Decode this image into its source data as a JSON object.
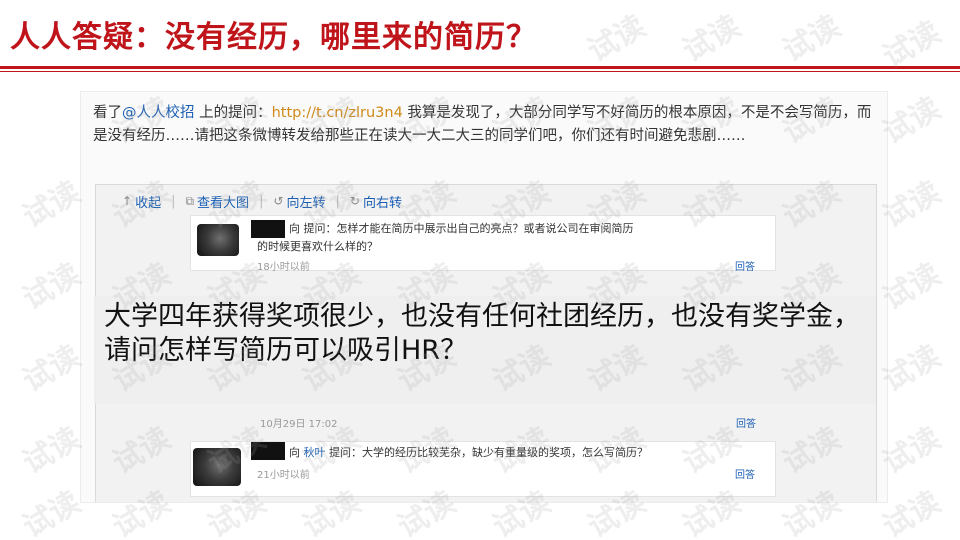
{
  "slide": {
    "title": "人人答疑：没有经历，哪里来的简历？"
  },
  "post": {
    "prefix": "看了",
    "mention": "@人人校招",
    "mid": " 上的提问：",
    "link": "http://t.cn/zlru3n4",
    "body": " 我算是发现了，大部分同学写不好简历的根本原因，不是不会写简历，而是没有经历……请把这条微博转发给那些正在读大一大二大三的同学们吧，你们还有时间避免悲剧……"
  },
  "toolbar": {
    "collapse": "收起",
    "view_large": "查看大图",
    "rotate_left": "向左转",
    "rotate_right": "向右转"
  },
  "comments": [
    {
      "to": "向",
      "user": "",
      "question": "提问：怎样才能在简历中展示出自己的亮点？或者说公司在审阅简历",
      "question_line2": "的时候更喜欢什么样的？",
      "time": "18小时以前",
      "reply": "回答"
    },
    {
      "time": "10月29日 17:02",
      "reply": "回答"
    },
    {
      "to": "向",
      "user": "秋叶",
      "question": "提问：大学的经历比较芜杂，缺少有重量级的奖项，怎么写简历？",
      "time": "21小时以前",
      "reply": "回答"
    }
  ],
  "overlay": {
    "text": "大学四年获得奖项很少，也没有任何社团经历，也没有奖学金，请问怎样写简历可以吸引HR？"
  },
  "watermark": {
    "text": "试读"
  }
}
